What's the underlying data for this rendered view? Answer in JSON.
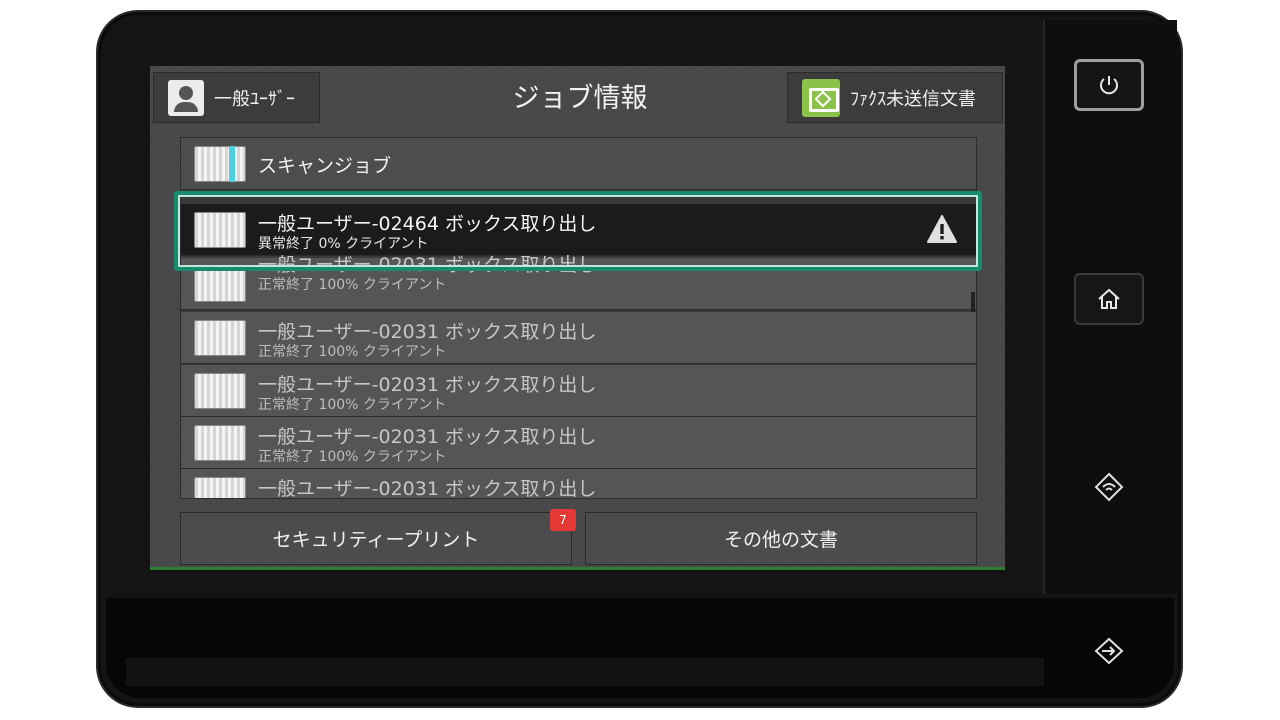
{
  "header": {
    "user_label": "一般ﾕｰｻﾞｰ",
    "title": "ジョブ情報",
    "fax_label": "ﾌｧｸｽ未送信文書"
  },
  "jobs": [
    {
      "title": "スキャンジョブ",
      "status": ""
    },
    {
      "title": "一般ユーザー-02464 ボックス取り出し",
      "status": "異常終了 0% クライアント",
      "selected": true,
      "warning": true
    },
    {
      "title": "一般ユーザー-02031 ボックス取り出し",
      "status": "正常終了 100% クライアント"
    },
    {
      "title": "一般ユーザー-02031 ボックス取り出し",
      "status": "正常終了 100% クライアント"
    },
    {
      "title": "一般ユーザー-02031 ボックス取り出し",
      "status": "正常終了 100% クライアント"
    },
    {
      "title": "一般ユーザー-02031 ボックス取り出し",
      "status": "正常終了 100% クライアント"
    },
    {
      "title": "一般ユーザー-02031 ボックス取り出し",
      "status": ""
    }
  ],
  "footer": {
    "security_print_label": "セキュリティープリント",
    "security_print_badge": "7",
    "other_docs_label": "その他の文書"
  },
  "colors": {
    "highlight": "#188b6e",
    "fax_icon": "#8bc34a",
    "badge": "#e53935",
    "scan_accent": "#4dd0e1"
  },
  "icons": {
    "power": "power-icon",
    "home": "home-icon",
    "nfc": "nfc-icon",
    "login": "login-icon",
    "warning": "warning-icon"
  }
}
